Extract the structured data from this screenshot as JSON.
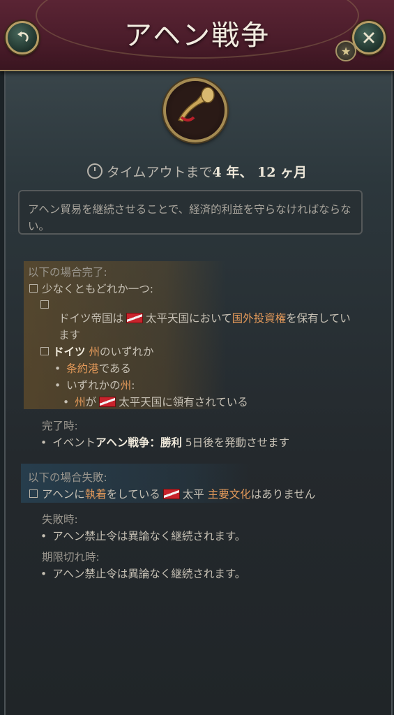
{
  "header": {
    "title": "アヘン戦争"
  },
  "timeout": {
    "prefix": "タイムアウトまで",
    "value": "4 年、 12 ヶ月"
  },
  "description": "アヘン貿易を継続させることで、経済的利益を守らなければならない。",
  "success": {
    "heading": "以下の場合完了:",
    "any_of": "少なくともどれか一つ:",
    "cond1_a": "ドイツ帝国は",
    "cond1_country": "太平天国",
    "cond1_b": "において",
    "cond1_hl": "国外投資権",
    "cond1_c": "を保有してい",
    "cond1_d": "ます",
    "cond2_a": "ドイツ",
    "cond2_hl": "州",
    "cond2_b": "のいずれか",
    "cond2_1_hl": "条約港",
    "cond2_1_b": "である",
    "cond2_2_a": "いずれかの",
    "cond2_2_hl": "州",
    "cond2_2_b": ":",
    "cond2_3_hl": "州",
    "cond2_3_a": "が",
    "cond2_3_country": "太平天国",
    "cond2_3_b": "に領有されている"
  },
  "on_complete": {
    "heading": "完了時:",
    "effect_a": "イベント",
    "effect_bold": "アヘン戦争：勝利",
    "effect_b": " 5日後を発動させます"
  },
  "failure": {
    "heading": "以下の場合失敗:",
    "cond_a": "アヘンに",
    "cond_hl1": "執着",
    "cond_b": "をしている",
    "cond_country": "太平",
    "cond_hl2": "主要文化",
    "cond_c": "はありません"
  },
  "on_fail": {
    "heading": "失敗時:",
    "effect": "アヘン禁止令は異論なく継続されます。"
  },
  "on_expire": {
    "heading": "期限切れ時:",
    "effect": "アヘン禁止令は異論なく継続されます。"
  },
  "icons": {
    "back": "back-arrow-icon",
    "close": "close-icon",
    "star": "star-icon",
    "emblem": "bugle-icon",
    "clock": "clock-icon"
  },
  "colors": {
    "header": "#4a1c2a",
    "gold": "#a08a5c",
    "highlight": "#e59a5a"
  }
}
